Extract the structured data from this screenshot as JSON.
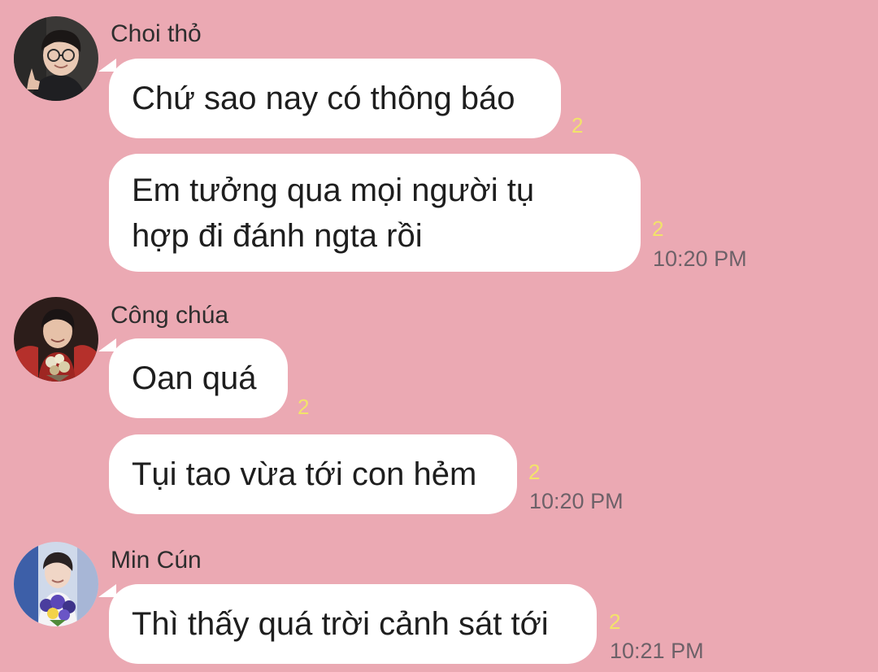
{
  "groups": [
    {
      "sender": "Choi thỏ",
      "avatar_icon": "avatar-photo-glasses-boy",
      "messages": [
        {
          "text": "Chứ sao nay có thông báo",
          "read_count": "2",
          "time": ""
        },
        {
          "text": "Em tưởng qua mọi người tụ\nhợp đi đánh ngta rồi",
          "read_count": "2",
          "time": "10:20 PM"
        }
      ]
    },
    {
      "sender": "Công chúa",
      "avatar_icon": "avatar-photo-boy-flowers",
      "messages": [
        {
          "text": "Oan quá",
          "read_count": "2",
          "time": ""
        },
        {
          "text": "Tụi tao vừa tới con hẻm",
          "read_count": "2",
          "time": "10:20 PM"
        }
      ]
    },
    {
      "sender": "Min Cún",
      "avatar_icon": "avatar-photo-boy-bouquet",
      "messages": [
        {
          "text": "Thì thấy quá trời cảnh sát tới",
          "read_count": "2",
          "time": "10:21 PM"
        }
      ]
    }
  ],
  "colors": {
    "background": "#eba9b3",
    "bubble": "#ffffff",
    "read_count": "#f2e36a",
    "time": "#6d6168"
  }
}
